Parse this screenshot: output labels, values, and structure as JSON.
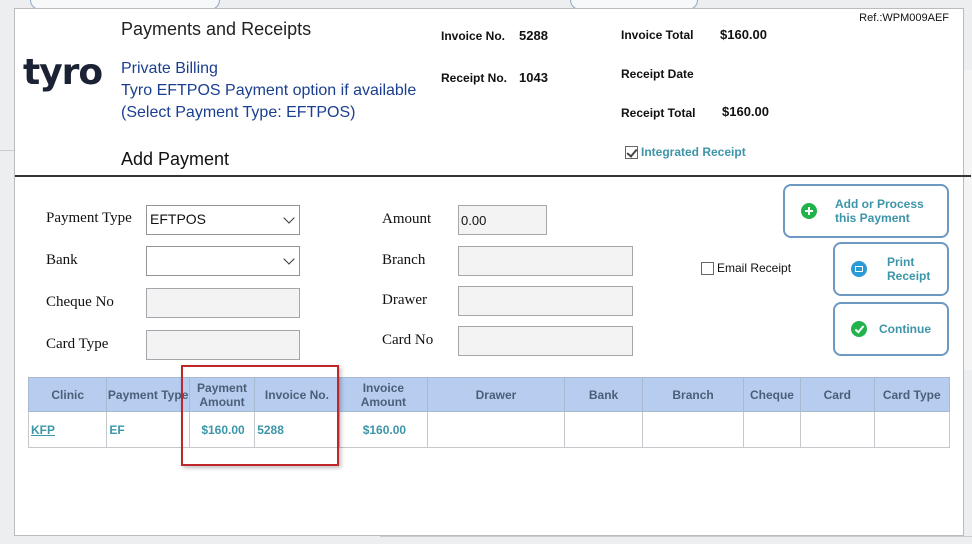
{
  "ref": "Ref.:WPM009AEF",
  "title": "Payments and Receipts",
  "logo": "tyro",
  "billing": {
    "line1": "Private Billing",
    "line2": "Tyro EFTPOS Payment option if available",
    "line3": "(Select Payment Type: EFTPOS)"
  },
  "section_title": "Add Payment",
  "invoice": {
    "invoice_no_label": "Invoice No.",
    "invoice_no": "5288",
    "receipt_no_label": "Receipt No.",
    "receipt_no": "1043",
    "invoice_total_label": "Invoice Total",
    "invoice_total": "$160.00",
    "receipt_date_label": "Receipt Date",
    "receipt_total_label": "Receipt Total",
    "receipt_total": "$160.00"
  },
  "integrated_receipt": {
    "label": "Integrated Receipt",
    "checked": true
  },
  "form": {
    "payment_type_label": "Payment Type",
    "payment_type_value": "EFTPOS",
    "bank_label": "Bank",
    "cheque_no_label": "Cheque No",
    "card_type_label": "Card Type",
    "amount_label": "Amount",
    "amount_value": "0.00",
    "branch_label": "Branch",
    "drawer_label": "Drawer",
    "card_no_label": "Card No"
  },
  "email_receipt": {
    "label": "Email Receipt",
    "checked": false
  },
  "buttons": {
    "add_process": "Add or Process this Payment",
    "print_receipt": "Print Receipt",
    "continue": "Continue"
  },
  "table": {
    "headers": [
      "Clinic",
      "Payment Type",
      "Payment Amount",
      "Invoice No.",
      "Invoice Amount",
      "Drawer",
      "Bank",
      "Branch",
      "Cheque",
      "Card",
      "Card Type"
    ],
    "rows": [
      [
        "KFP",
        "EF",
        "$160.00",
        "5288",
        "$160.00",
        "",
        "",
        "",
        "",
        "",
        ""
      ]
    ]
  },
  "colors": {
    "accent_teal": "#3c95a8",
    "billing_blue": "#1b3f8f",
    "header_bg": "#b6cdef",
    "highlight_red": "#c0272d",
    "icon_green": "#22b24c"
  }
}
